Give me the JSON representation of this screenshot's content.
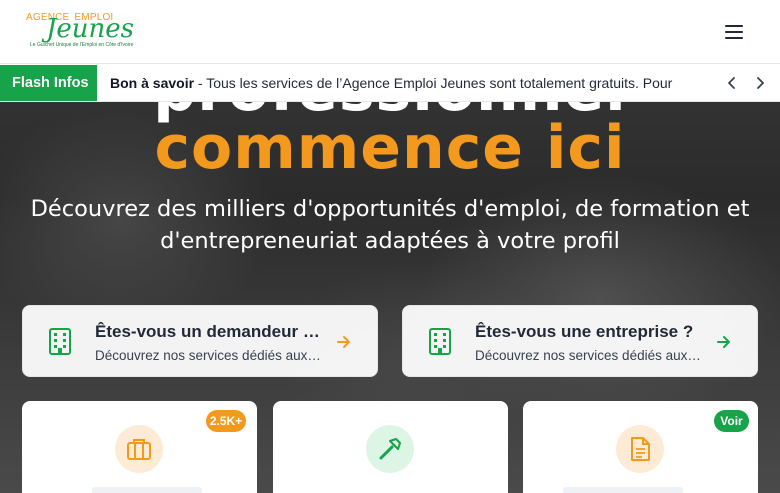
{
  "header": {
    "logo": {
      "top_text_a": "AGENCE",
      "top_text_b": "EMPLOI",
      "main_text": "Jeunes",
      "tagline": "Le Guichet Unique de l'Emploi en Côte d'Ivoire"
    },
    "menu_icon": "hamburger-icon"
  },
  "flash": {
    "label": "Flash Infos",
    "bold": "Bon à savoir",
    "text": " - Tous les services de l’Agence Emploi Jeunes sont totalement gratuits. Pour",
    "prev_icon": "chevron-left-icon",
    "next_icon": "chevron-right-icon"
  },
  "hero": {
    "title_line1": "professionnel",
    "title_line2": "commence ici",
    "subtitle": "Découvrez des milliers d'opportunités d'emploi, de formation et d'entrepreneuriat adaptées à votre profil"
  },
  "cards": [
    {
      "title": "Êtes-vous un demandeur d'emploi ?",
      "desc": "Découvrez nos services dédiés aux demandeurs",
      "icon": "building-icon"
    },
    {
      "title": "Êtes-vous une entreprise ?",
      "desc": "Découvrez nos services dédiés aux entreprises",
      "icon": "building-icon"
    }
  ],
  "tiles": [
    {
      "icon": "briefcase-icon",
      "badge": "2.5K+"
    },
    {
      "icon": "hammer-icon"
    },
    {
      "icon": "document-icon",
      "badge": "Voir"
    }
  ],
  "colors": {
    "brand_green": "#16a34a",
    "accent_orange": "#f39a1e",
    "white": "#ffffff"
  }
}
